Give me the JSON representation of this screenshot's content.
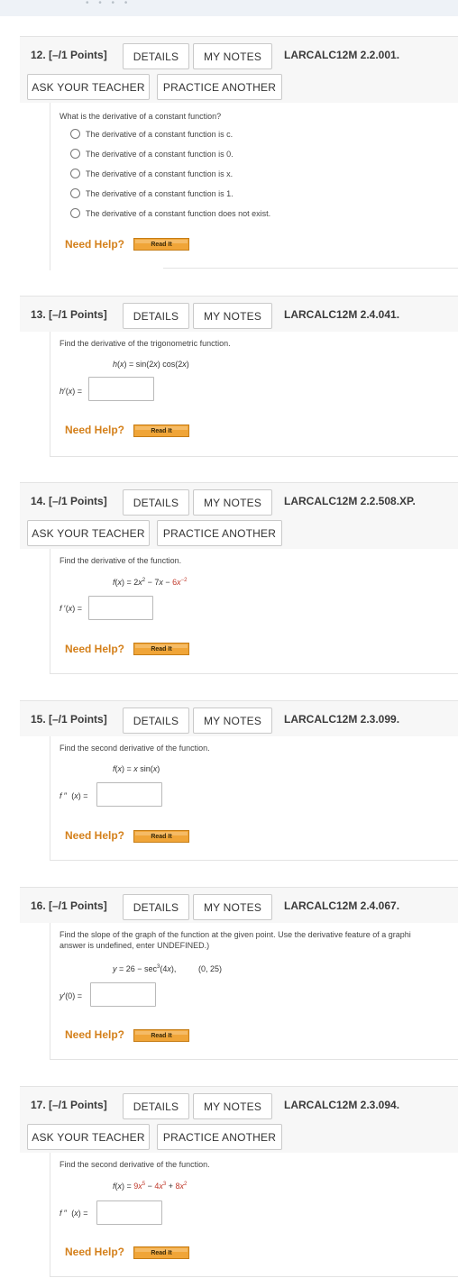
{
  "top_band": {
    "dots": "• • • •"
  },
  "q12": {
    "number": "12. [–/1 Points]",
    "details": "DETAILS",
    "notes": "MY NOTES",
    "code": "LARCALC12M 2.2.001.",
    "ask": "ASK YOUR TEACHER",
    "practice": "PRACTICE ANOTHER",
    "question": "What is the derivative of a constant function?",
    "options": [
      "The derivative of a constant function is c.",
      "The derivative of a constant function is 0.",
      "The derivative of a constant function is x.",
      "The derivative of a constant function is 1.",
      "The derivative of a constant function does not exist."
    ],
    "help": "Need Help?",
    "read": "Read It"
  },
  "q13": {
    "number": "13. [–/1 Points]",
    "details": "DETAILS",
    "notes": "MY NOTES",
    "code": "LARCALC12M 2.4.041.",
    "question": "Find the derivative of the trigonometric function.",
    "formula": "h(x) = sin(2x) cos(2x)",
    "answer_label": "h′(x) =",
    "answer_value": "",
    "help": "Need Help?",
    "read": "Read It"
  },
  "q14": {
    "number": "14. [–/1 Points]",
    "details": "DETAILS",
    "notes": "MY NOTES",
    "code": "LARCALC12M 2.2.508.XP.",
    "ask": "ASK YOUR TEACHER",
    "practice": "PRACTICE ANOTHER",
    "question": "Find the derivative of the function.",
    "formula": "f(x) = 2x² − 7x − 6x⁻²",
    "answer_label": "f′(x) =",
    "answer_value": "",
    "help": "Need Help?",
    "read": "Read It"
  },
  "q15": {
    "number": "15. [–/1 Points]",
    "details": "DETAILS",
    "notes": "MY NOTES",
    "code": "LARCALC12M 2.3.099.",
    "question": "Find the second derivative of the function.",
    "formula": "f(x) = x sin(x)",
    "answer_label": "f ″ (x) =",
    "answer_value": "",
    "help": "Need Help?",
    "read": "Read It"
  },
  "q16": {
    "number": "16. [–/1 Points]",
    "details": "DETAILS",
    "notes": "MY NOTES",
    "code": "LARCALC12M 2.4.067.",
    "question_line1": "Find the slope of the graph of the function at the given point. Use the derivative feature of a graphi",
    "question_line2": "answer is undefined, enter UNDEFINED.)",
    "formula": "y = 26 − sec³(4x),",
    "point": "(0, 25)",
    "answer_label": "y′(0) =",
    "answer_value": "",
    "help": "Need Help?",
    "read": "Read It"
  },
  "q17": {
    "number": "17. [–/1 Points]",
    "details": "DETAILS",
    "notes": "MY NOTES",
    "code": "LARCALC12M 2.3.094.",
    "ask": "ASK YOUR TEACHER",
    "practice": "PRACTICE ANOTHER",
    "question": "Find the second derivative of the function.",
    "formula": "f(x) = 9x⁵ − 4x³ + 8x²",
    "answer_label": "f ″ (x) =",
    "answer_value": "",
    "help": "Need Help?",
    "read": "Read It"
  }
}
